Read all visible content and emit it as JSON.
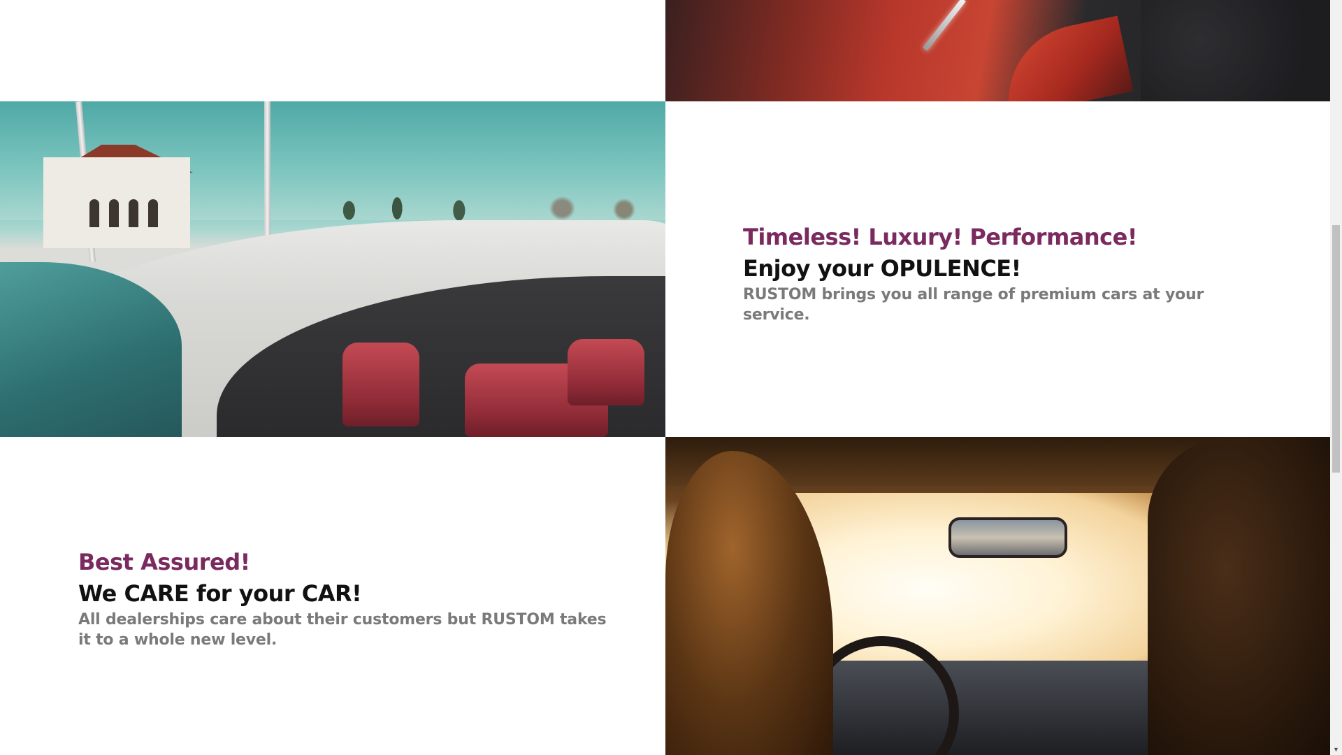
{
  "sections": [
    {
      "tagline": "Timeless! Luxury! Performance!",
      "headline": "Enjoy your OPULENCE!",
      "body": "RUSTOM brings you all range of premium cars at your service."
    },
    {
      "tagline": "Best Assured!",
      "headline": "We CARE for your CAR!",
      "body": "All dealerships care about their customers but RUSTOM takes it to a whole new level."
    }
  ],
  "colors": {
    "tagline": "#7b2a5f",
    "headline": "#111111",
    "body": "#7a7a7a",
    "background": "#ffffff"
  },
  "icons": {
    "scroll_down": "chevron-down-icon"
  }
}
